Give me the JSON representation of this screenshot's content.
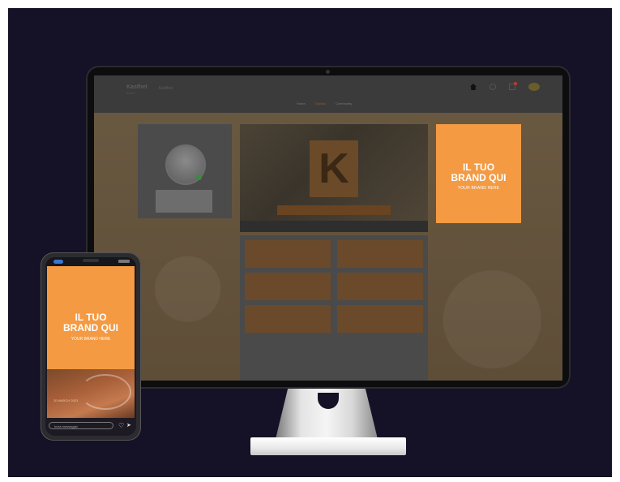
{
  "desktop": {
    "header": {
      "logo": "Kasthet",
      "logo_sub": "Brand",
      "breadcrumb": "Kasthet",
      "nav": [
        {
          "label": "Home",
          "active": false
        },
        {
          "label": "Digitale",
          "active": true
        },
        {
          "label": "Community",
          "active": false
        }
      ],
      "icons": [
        "home-icon",
        "search-icon",
        "cart-icon",
        "avatar-icon"
      ]
    },
    "brand_box": {
      "title": "IL TUO\nBRAND QUI",
      "subtitle": "YOUR BRAND HERE",
      "color": "#f39a43"
    },
    "menu_buttons": [
      "",
      "",
      "",
      "",
      "",
      ""
    ]
  },
  "phone": {
    "brand_box": {
      "title": "IL TUO\nBRAND QUI",
      "subtitle": "YOUR BRAND HERE",
      "color": "#f39a43"
    },
    "story_date": "20 MARCH 2023",
    "message_placeholder": "Invia messaggio",
    "icons": [
      "heart-icon",
      "send-icon"
    ]
  },
  "colors": {
    "background": "#151127",
    "accent": "#f39a43"
  }
}
